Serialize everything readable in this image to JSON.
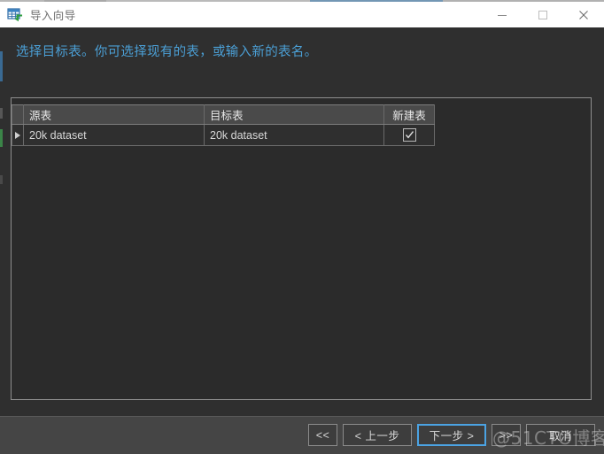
{
  "window": {
    "title": "导入向导",
    "icon": "import-table-icon",
    "controls": {
      "minimize": "minimize-icon",
      "maximize": "maximize-icon",
      "close": "close-icon"
    }
  },
  "header": {
    "message": "选择目标表。你可选择现有的表，或输入新的表名。",
    "accent_color": "#4b9fd5"
  },
  "grid": {
    "columns": [
      "源表",
      "目标表",
      "新建表"
    ],
    "rows": [
      {
        "marker": "▶",
        "source_table": "20k dataset",
        "target_table": "20k dataset",
        "new_table_checked": true
      }
    ]
  },
  "footer": {
    "buttons": [
      {
        "name": "first-button",
        "label": "<<",
        "primary": false
      },
      {
        "name": "previous-button",
        "label": "< 上一步",
        "primary": false
      },
      {
        "name": "next-button",
        "label": "下一步 >",
        "primary": true
      },
      {
        "name": "last-button",
        "label": ">>",
        "primary": false
      },
      {
        "name": "cancel-button",
        "label": "取消",
        "primary": false
      }
    ],
    "focus_color": "#4ba3e3"
  },
  "watermark": {
    "text": "@51CTO博客"
  }
}
